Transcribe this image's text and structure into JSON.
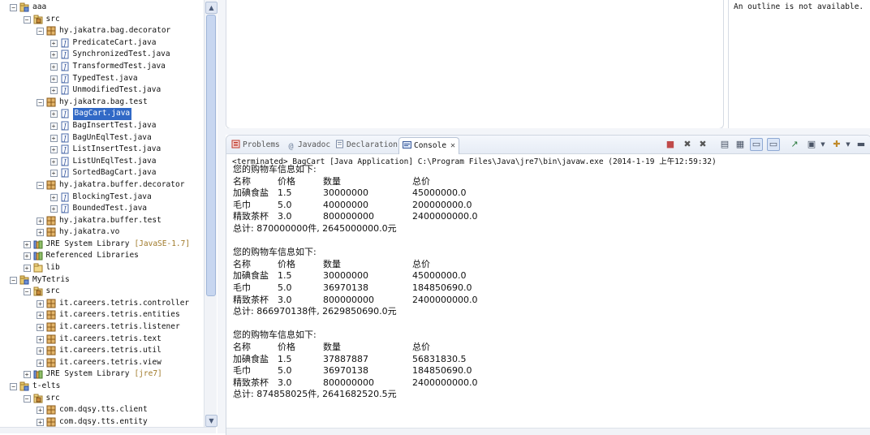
{
  "explorer": {
    "tree": [
      {
        "depth": 0,
        "expander": "−",
        "icon": "project",
        "label": "aaa"
      },
      {
        "depth": 1,
        "expander": "−",
        "icon": "src",
        "label": "src"
      },
      {
        "depth": 2,
        "expander": "−",
        "icon": "package",
        "label": "hy.jakatra.bag.decorator"
      },
      {
        "depth": 3,
        "expander": "+",
        "icon": "java",
        "label": "PredicateCart.java"
      },
      {
        "depth": 3,
        "expander": "+",
        "icon": "java",
        "label": "SynchronizedTest.java"
      },
      {
        "depth": 3,
        "expander": "+",
        "icon": "java",
        "label": "TransformedTest.java"
      },
      {
        "depth": 3,
        "expander": "+",
        "icon": "java",
        "label": "TypedTest.java"
      },
      {
        "depth": 3,
        "expander": "+",
        "icon": "java",
        "label": "UnmodifiedTest.java"
      },
      {
        "depth": 2,
        "expander": "−",
        "icon": "package",
        "label": "hy.jakatra.bag.test"
      },
      {
        "depth": 3,
        "expander": "+",
        "icon": "java",
        "label": "BagCart.java",
        "selected": true
      },
      {
        "depth": 3,
        "expander": "+",
        "icon": "java",
        "label": "BagInsertTest.java"
      },
      {
        "depth": 3,
        "expander": "+",
        "icon": "java",
        "label": "BagUnEqlTest.java"
      },
      {
        "depth": 3,
        "expander": "+",
        "icon": "java",
        "label": "ListInsertTest.java"
      },
      {
        "depth": 3,
        "expander": "+",
        "icon": "java",
        "label": "ListUnEqlTest.java"
      },
      {
        "depth": 3,
        "expander": "+",
        "icon": "java",
        "label": "SortedBagCart.java"
      },
      {
        "depth": 2,
        "expander": "−",
        "icon": "package",
        "label": "hy.jakatra.buffer.decorator"
      },
      {
        "depth": 3,
        "expander": "+",
        "icon": "java",
        "label": "BlockingTest.java"
      },
      {
        "depth": 3,
        "expander": "+",
        "icon": "java",
        "label": "BoundedTest.java"
      },
      {
        "depth": 2,
        "expander": "+",
        "icon": "package",
        "label": "hy.jakatra.buffer.test"
      },
      {
        "depth": 2,
        "expander": "+",
        "icon": "package",
        "label": "hy.jakatra.vo"
      },
      {
        "depth": 1,
        "expander": "+",
        "icon": "library",
        "label": "JRE System Library",
        "decoration": "[JavaSE-1.7]"
      },
      {
        "depth": 1,
        "expander": "+",
        "icon": "library",
        "label": "Referenced Libraries"
      },
      {
        "depth": 1,
        "expander": "+",
        "icon": "folder",
        "label": "lib"
      },
      {
        "depth": 0,
        "expander": "−",
        "icon": "project",
        "label": "MyTetris"
      },
      {
        "depth": 1,
        "expander": "−",
        "icon": "src",
        "label": "src"
      },
      {
        "depth": 2,
        "expander": "+",
        "icon": "package",
        "label": "it.careers.tetris.controller"
      },
      {
        "depth": 2,
        "expander": "+",
        "icon": "package",
        "label": "it.careers.tetris.entities"
      },
      {
        "depth": 2,
        "expander": "+",
        "icon": "package",
        "label": "it.careers.tetris.listener"
      },
      {
        "depth": 2,
        "expander": "+",
        "icon": "package",
        "label": "it.careers.tetris.text"
      },
      {
        "depth": 2,
        "expander": "+",
        "icon": "package",
        "label": "it.careers.tetris.util"
      },
      {
        "depth": 2,
        "expander": "+",
        "icon": "package",
        "label": "it.careers.tetris.view"
      },
      {
        "depth": 1,
        "expander": "+",
        "icon": "library",
        "label": "JRE System Library",
        "decoration": "[jre7]"
      },
      {
        "depth": 0,
        "expander": "−",
        "icon": "project",
        "label": "t-elts"
      },
      {
        "depth": 1,
        "expander": "−",
        "icon": "src",
        "label": "src"
      },
      {
        "depth": 2,
        "expander": "+",
        "icon": "package",
        "label": "com.dqsy.tts.client"
      },
      {
        "depth": 2,
        "expander": "+",
        "icon": "package",
        "label": "com.dqsy.tts.entity"
      }
    ]
  },
  "outline": {
    "message": "An outline is not available."
  },
  "console": {
    "tabs": [
      {
        "label": "Problems",
        "icon": "problems-icon",
        "active": false
      },
      {
        "label": "Javadoc",
        "icon": "javadoc-icon",
        "active": false
      },
      {
        "label": "Declaration",
        "icon": "declaration-icon",
        "active": false
      },
      {
        "label": "Console",
        "icon": "console-icon",
        "active": true
      }
    ],
    "close_glyph": "✕",
    "process_line": "<terminated> BagCart [Java Application] C:\\Program Files\\Java\\jre7\\bin\\javaw.exe (2014-1-19 上午12:59:32)",
    "blocks": [
      {
        "heading": "您的购物车信息如下:",
        "columns": [
          "名称",
          "价格",
          "数量",
          "总价"
        ],
        "rows": [
          [
            "加碘食盐",
            "1.5",
            "30000000",
            "45000000.0"
          ],
          [
            "毛巾",
            "5.0",
            "40000000",
            "200000000.0"
          ],
          [
            "精致茶杯",
            "3.0",
            "800000000",
            "2400000000.0"
          ]
        ],
        "total": "总计: 870000000件, 2645000000.0元"
      },
      {
        "heading": "您的购物车信息如下:",
        "columns": [
          "名称",
          "价格",
          "数量",
          "总价"
        ],
        "rows": [
          [
            "加碘食盐",
            "1.5",
            "30000000",
            "45000000.0"
          ],
          [
            "毛巾",
            "5.0",
            "36970138",
            "184850690.0"
          ],
          [
            "精致茶杯",
            "3.0",
            "800000000",
            "2400000000.0"
          ]
        ],
        "total": "总计: 866970138件, 2629850690.0元"
      },
      {
        "heading": "您的购物车信息如下:",
        "columns": [
          "名称",
          "价格",
          "数量",
          "总价"
        ],
        "rows": [
          [
            "加碘食盐",
            "1.5",
            "37887887",
            "56831830.5"
          ],
          [
            "毛巾",
            "5.0",
            "36970138",
            "184850690.0"
          ],
          [
            "精致茶杯",
            "3.0",
            "800000000",
            "2400000000.0"
          ]
        ],
        "total": "总计: 874858025件, 2641682520.5元"
      }
    ]
  },
  "colors": {
    "selection": "#3169c6",
    "decoration": "#a07a2a"
  }
}
